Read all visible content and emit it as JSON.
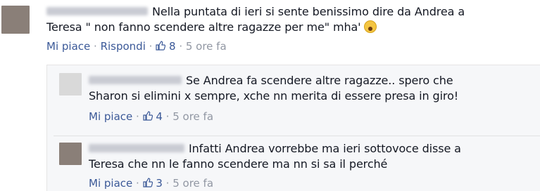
{
  "comments": [
    {
      "text_line1": "Nella puntata di ieri si sente benissimo dire da Andrea a",
      "text_line2": "Teresa \" non fanno scendere altre ragazze per me\" mha'",
      "like_label": "Mi piace",
      "reply_label": "Rispondi",
      "like_count": "8",
      "time": "5 ore fa",
      "avatar_color": "#8a7f78"
    }
  ],
  "replies": [
    {
      "text_line1": "Se Andrea fa scendere altre ragazze.. spero che",
      "text_line2": "Sharon si elimini x sempre, xche nn merita di essere presa in giro!",
      "like_label": "Mi piace",
      "like_count": "4",
      "time": "5 ore fa",
      "avatar_color": "#d8d8d8"
    },
    {
      "text_line1": "Infatti Andrea vorrebbe ma ieri sottovoce disse a",
      "text_line2": "Teresa che nn le fanno scendere ma nn si sa il perché",
      "like_label": "Mi piace",
      "like_count": "3",
      "time": "5 ore fa",
      "avatar_color": "#8a7f78"
    }
  ],
  "colors": {
    "link": "#3b5998",
    "meta": "#9197a3",
    "text": "#141823",
    "reply_bg": "#f6f7f9"
  },
  "icons": [
    "thumbs-up-icon",
    "fearful-face-emoji"
  ]
}
